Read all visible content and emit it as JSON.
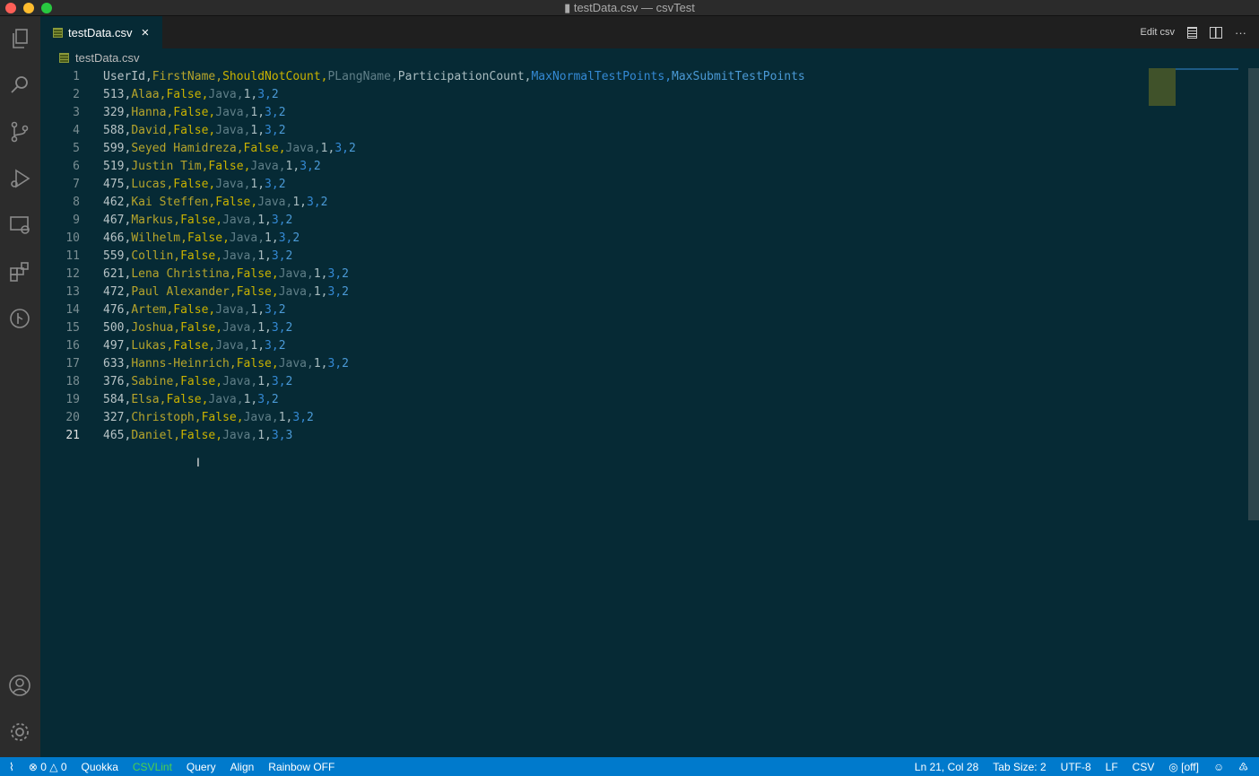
{
  "window": {
    "title": "testData.csv — csvTest"
  },
  "tab": {
    "label": "testData.csv",
    "close": "×"
  },
  "toolbar": {
    "edit_csv": "Edit csv",
    "more": "···"
  },
  "breadcrumb": {
    "file": "testData.csv"
  },
  "editor": {
    "current_line": 21,
    "rows": [
      [
        "UserId",
        "FirstName",
        "ShouldNotCount",
        "PLangName",
        "ParticipationCount",
        "MaxNormalTestPoints",
        "MaxSubmitTestPoints"
      ],
      [
        "513",
        "Alaa",
        "False",
        "Java",
        "1",
        "3",
        "2"
      ],
      [
        "329",
        "Hanna",
        "False",
        "Java",
        "1",
        "3",
        "2"
      ],
      [
        "588",
        "David",
        "False",
        "Java",
        "1",
        "3",
        "2"
      ],
      [
        "599",
        "Seyed Hamidreza",
        "False",
        "Java",
        "1",
        "3",
        "2"
      ],
      [
        "519",
        "Justin Tim",
        "False",
        "Java",
        "1",
        "3",
        "2"
      ],
      [
        "475",
        "Lucas",
        "False",
        "Java",
        "1",
        "3",
        "2"
      ],
      [
        "462",
        "Kai Steffen",
        "False",
        "Java",
        "1",
        "3",
        "2"
      ],
      [
        "467",
        "Markus",
        "False",
        "Java",
        "1",
        "3",
        "2"
      ],
      [
        "466",
        "Wilhelm",
        "False",
        "Java",
        "1",
        "3",
        "2"
      ],
      [
        "559",
        "Collin",
        "False",
        "Java",
        "1",
        "3",
        "2"
      ],
      [
        "621",
        "Lena Christina",
        "False",
        "Java",
        "1",
        "3",
        "2"
      ],
      [
        "472",
        "Paul Alexander",
        "False",
        "Java",
        "1",
        "3",
        "2"
      ],
      [
        "476",
        "Artem",
        "False",
        "Java",
        "1",
        "3",
        "2"
      ],
      [
        "500",
        "Joshua",
        "False",
        "Java",
        "1",
        "3",
        "2"
      ],
      [
        "497",
        "Lukas",
        "False",
        "Java",
        "1",
        "3",
        "2"
      ],
      [
        "633",
        "Hanns-Heinrich",
        "False",
        "Java",
        "1",
        "3",
        "2"
      ],
      [
        "376",
        "Sabine",
        "False",
        "Java",
        "1",
        "3",
        "2"
      ],
      [
        "584",
        "Elsa",
        "False",
        "Java",
        "1",
        "3",
        "2"
      ],
      [
        "327",
        "Christoph",
        "False",
        "Java",
        "1",
        "3",
        "2"
      ],
      [
        "465",
        "Daniel",
        "False",
        "Java",
        "1",
        "3",
        "3"
      ]
    ]
  },
  "status": {
    "errors": "0",
    "warnings": "0",
    "quokka": "Quokka",
    "csvlint": "CSVLint",
    "query": "Query",
    "align": "Align",
    "rainbow": "Rainbow OFF",
    "position": "Ln 21, Col 28",
    "tab_size": "Tab Size: 2",
    "encoding": "UTF-8",
    "eol": "LF",
    "language": "CSV",
    "live": "[off]"
  },
  "colors": {
    "status_bar": "#007acc",
    "editor_bg": "#062a35",
    "csvlint": "#4cd04c"
  }
}
